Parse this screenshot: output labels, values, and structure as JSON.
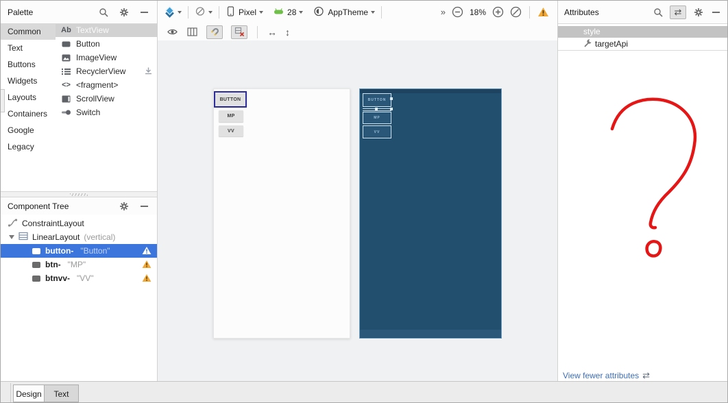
{
  "colors": {
    "selection_blue": "#3c76dd",
    "warning_yellow": "#f1a836",
    "blueprint_bg": "#234f6e",
    "annotation_red": "#e41616",
    "link_blue": "#3e6db5"
  },
  "palette": {
    "title": "Palette",
    "categories": [
      {
        "label": "Common",
        "selected": true
      },
      {
        "label": "Text"
      },
      {
        "label": "Buttons"
      },
      {
        "label": "Widgets"
      },
      {
        "label": "Layouts"
      },
      {
        "label": "Containers"
      },
      {
        "label": "Google"
      },
      {
        "label": "Legacy"
      }
    ],
    "items": [
      {
        "label": "TextView",
        "selected": true
      },
      {
        "label": "Button"
      },
      {
        "label": "ImageView"
      },
      {
        "label": "RecyclerView",
        "downloadable": true
      },
      {
        "label": "<fragment>"
      },
      {
        "label": "ScrollView"
      },
      {
        "label": "Switch"
      }
    ]
  },
  "component_tree": {
    "title": "Component Tree",
    "nodes": [
      {
        "label": "ConstraintLayout"
      },
      {
        "label": "LinearLayout",
        "suffix": "(vertical)"
      },
      {
        "name": "button-",
        "value": "\"Button\"",
        "selected": true,
        "warning": true
      },
      {
        "name": "btn-",
        "value": "\"MP\"",
        "warning": true
      },
      {
        "name": "btnvv-",
        "value": "\"VV\"",
        "warning": true
      }
    ]
  },
  "toolbar": {
    "device": "Pixel",
    "api_level": "28",
    "theme": "AppTheme",
    "zoom_level": "18%"
  },
  "preview": {
    "buttons": [
      "BUTTON",
      "MP",
      "VV"
    ]
  },
  "attributes": {
    "title": "Attributes",
    "rows": [
      {
        "label": "style"
      },
      {
        "label": "targetApi"
      }
    ],
    "footer_link": "View fewer attributes"
  },
  "bottom_tabs": [
    {
      "label": "Design",
      "selected": true
    },
    {
      "label": "Text"
    }
  ],
  "icons": {
    "textview_glyph": "Ab",
    "fragment_glyph": "<>",
    "chevrons": "»",
    "arrow_horizontal": "↔",
    "arrow_vertical": "↕",
    "swap": "⇄"
  }
}
